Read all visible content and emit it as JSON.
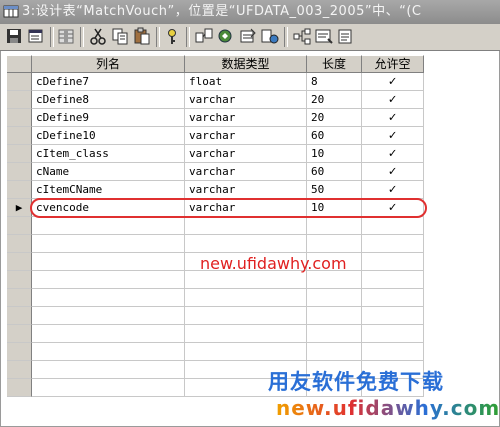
{
  "window": {
    "title": "3:设计表“MatchVouch”，位置是“UFDATA_003_2005”中、“(C"
  },
  "toolbar": {
    "buttons": [
      {
        "name": "save-icon"
      },
      {
        "name": "properties-icon"
      },
      {
        "name": "insert-column-icon"
      },
      {
        "name": "cut-icon"
      },
      {
        "name": "copy-icon"
      },
      {
        "name": "paste-icon"
      },
      {
        "name": "primary-key-icon"
      },
      {
        "name": "relationships-icon"
      },
      {
        "name": "indexes-icon"
      },
      {
        "name": "constraints-icon"
      },
      {
        "name": "triggers-icon"
      },
      {
        "name": "dependencies-icon"
      },
      {
        "name": "sql-icon"
      },
      {
        "name": "more-icon"
      }
    ]
  },
  "grid": {
    "columns": [
      "列名",
      "数据类型",
      "长度",
      "允许空"
    ],
    "rows": [
      {
        "name": "cDefine7",
        "type": "float",
        "length": "8",
        "nullable": "✓"
      },
      {
        "name": "cDefine8",
        "type": "varchar",
        "length": "20",
        "nullable": "✓"
      },
      {
        "name": "cDefine9",
        "type": "varchar",
        "length": "20",
        "nullable": "✓"
      },
      {
        "name": "cDefine10",
        "type": "varchar",
        "length": "60",
        "nullable": "✓"
      },
      {
        "name": "cItem_class",
        "type": "varchar",
        "length": "10",
        "nullable": "✓"
      },
      {
        "name": "cName",
        "type": "varchar",
        "length": "60",
        "nullable": "✓"
      },
      {
        "name": "cItemCName",
        "type": "varchar",
        "length": "50",
        "nullable": "✓"
      },
      {
        "name": "cvencode",
        "type": "varchar",
        "length": "10",
        "nullable": "✓"
      }
    ],
    "current_row_marker": "▶"
  },
  "annotation": {
    "watermark_url": "new.ufidawhy.com",
    "brand_title": "用友软件免费下载",
    "brand_url": "new.ufidawhy.com",
    "colors": {
      "highlight": "#e03030",
      "brand_blue": "#2a6fd6"
    }
  }
}
